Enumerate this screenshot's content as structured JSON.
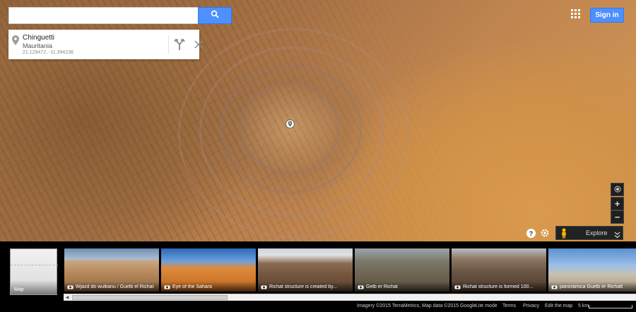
{
  "search": {
    "value": "",
    "placeholder": ""
  },
  "place_card": {
    "name": "Chinguetti",
    "country": "Mauritania",
    "coordinates": "21.129472, -11.394238"
  },
  "header": {
    "sign_in_label": "Sign in"
  },
  "controls": {
    "zoom_in_label": "+",
    "zoom_out_label": "−",
    "help_label": "?",
    "explore_label": "Explore"
  },
  "photo_strip": {
    "map_label": "Map",
    "photos": [
      {
        "caption": "Wjazd do wulkanu / Guelb el Richat"
      },
      {
        "caption": "Eye of the Sahara"
      },
      {
        "caption": "Richat structure is created by..."
      },
      {
        "caption": "Gelb er Richat"
      },
      {
        "caption": "Richat structure is formed 100..."
      },
      {
        "caption": "panorámica Guelb er Richatt"
      }
    ]
  },
  "footer": {
    "imagery": "Imagery ©2015 TerraMetrics, Map data ©2015 Google",
    "lite_mode": "Lite mode",
    "terms": "Terms",
    "privacy": "Privacy",
    "edit_map": "Edit the map",
    "scale": "5 km"
  },
  "colors": {
    "accent": "#4d90fe",
    "control_bg": "#1f1f1f"
  }
}
